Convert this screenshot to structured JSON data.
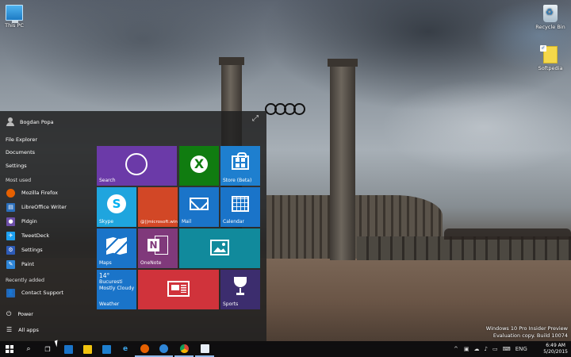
{
  "desktop": {
    "icons": [
      {
        "label": "This PC"
      },
      {
        "label": "Recycle Bin"
      },
      {
        "label": "Softpedia"
      }
    ],
    "watermark": {
      "line1": "Windows 10 Pro Insider Preview",
      "line2": "Evaluation copy. Build 10074"
    }
  },
  "start_menu": {
    "user": "Bogdan Popa",
    "places": [
      "File Explorer",
      "Documents",
      "Settings"
    ],
    "most_used_title": "Most used",
    "most_used": [
      {
        "label": "Mozilla Firefox",
        "icon": "firefox-icon",
        "color": "#e66000"
      },
      {
        "label": "LibreOffice Writer",
        "icon": "writer-icon",
        "color": "#2a6ebb"
      },
      {
        "label": "Pidgin",
        "icon": "pidgin-icon",
        "color": "#6d4fa8"
      },
      {
        "label": "TweetDeck",
        "icon": "tweetdeck-icon",
        "color": "#1da1f2"
      },
      {
        "label": "Settings",
        "icon": "gear-icon",
        "color": "#2d5bb7"
      },
      {
        "label": "Paint",
        "icon": "paint-icon",
        "color": "#2f86d8"
      }
    ],
    "recently_added_title": "Recently added",
    "recently_added": [
      {
        "label": "Contact Support",
        "icon": "support-icon",
        "color": "#2167b8"
      }
    ],
    "power_label": "Power",
    "all_apps_label": "All apps",
    "tiles": {
      "search": "Search",
      "xbox": "",
      "store": "Store (Beta)",
      "skype": "Skype",
      "account": "@||microsoft.win",
      "mail": "Mail",
      "calendar": "Calendar",
      "maps": "Maps",
      "onenote": "OneNote",
      "photos": "",
      "weather": "Weather",
      "weather_temp": "14°",
      "weather_city": "Bucuresti",
      "weather_cond": "Mostly Cloudy",
      "news": "",
      "sports": "Sports"
    },
    "colors": {
      "search": "#6b3aa8",
      "xbox": "#107c10",
      "store": "#1e7fcf",
      "skype": "#1fa5de",
      "account": "#d24726",
      "mail": "#1a74c9",
      "calendar": "#1a74c9",
      "maps": "#1a74c9",
      "onenote": "#80397b",
      "photos": "#118a9c",
      "weather": "#1a74c9",
      "news": "#d0333b",
      "sports": "#3c2d6e"
    }
  },
  "taskbar": {
    "items": [
      "start-icon",
      "search-icon",
      "task-view-icon",
      "app-icon",
      "file-explorer-icon",
      "store-icon",
      "edge-icon",
      "firefox-icon",
      "outlook-icon",
      "chrome-icon",
      "writer-icon"
    ],
    "tray_lang": "ENG",
    "time": "6:49 AM",
    "date": "5/20/2015"
  }
}
